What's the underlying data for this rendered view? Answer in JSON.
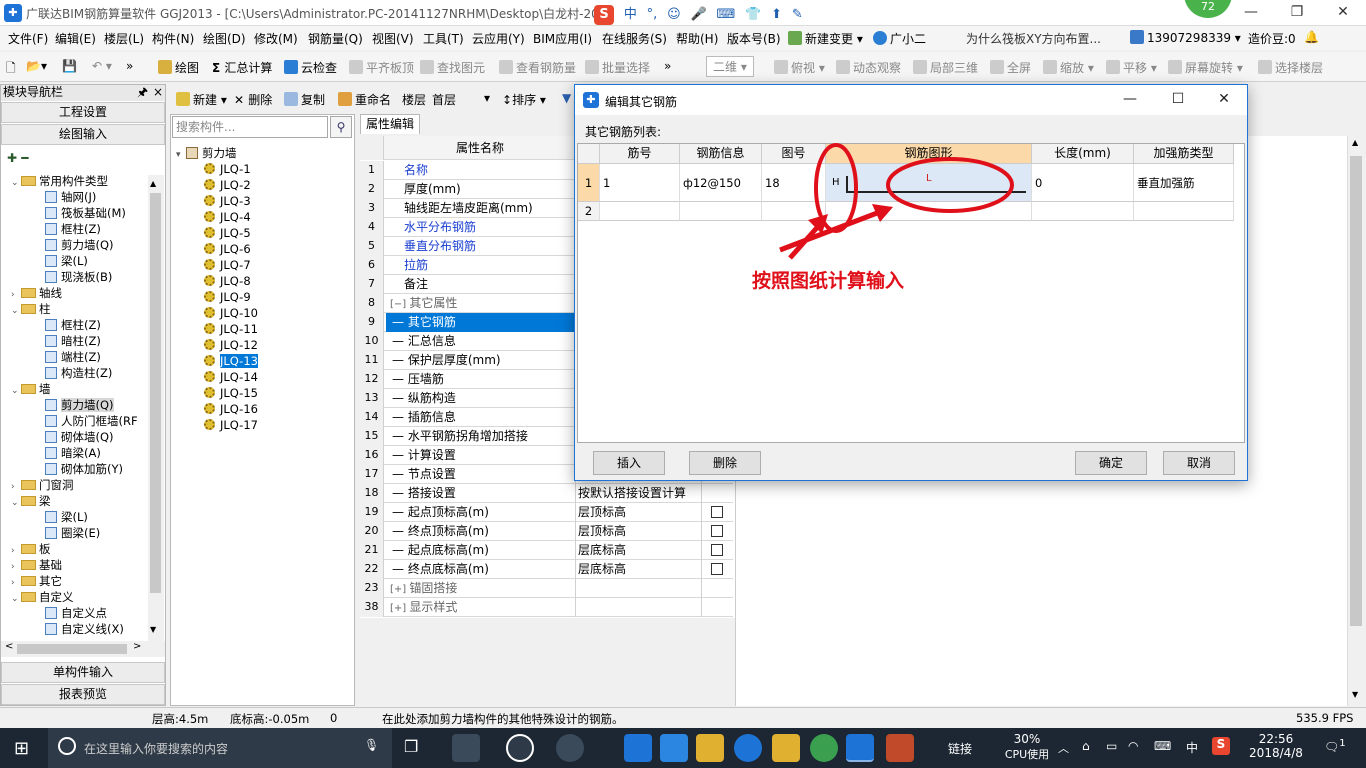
{
  "window": {
    "title": "广联达BIM钢筋算量软件 GGJ2013 - [C:\\Users\\Administrator.PC-20141127NRHM\\Desktop\\白龙村-20",
    "ime_label": "中",
    "badge_count": "72"
  },
  "menu": [
    "文件(F)",
    "编辑(E)",
    "楼层(L)",
    "构件(N)",
    "绘图(D)",
    "修改(M)",
    "钢筋量(Q)",
    "视图(V)",
    "工具(T)",
    "云应用(Y)",
    "BIM应用(I)",
    "在线服务(S)",
    "帮助(H)",
    "版本号(B)",
    "新建变更",
    "广小二"
  ],
  "menu_extra": {
    "link": "为什么筏板XY方向布置...",
    "phone": "13907298339",
    "price": "造价豆:0"
  },
  "toolbar": [
    "绘图",
    "汇总计算",
    "云检查",
    "平齐板顶",
    "查找图元",
    "查看钢筋量",
    "批量选择",
    "二维",
    "俯视",
    "动态观察",
    "局部三维",
    "全屏",
    "缩放",
    "平移",
    "屏幕旋转",
    "选择楼层"
  ],
  "nav": {
    "header": "模块导航栏",
    "btn_project": "工程设置",
    "btn_draw": "绘图输入",
    "btn_single": "单构件输入",
    "btn_report": "报表预览",
    "tree": [
      {
        "label": "常用构件类型",
        "level": 0,
        "type": "folder",
        "open": true
      },
      {
        "label": "轴网(J)",
        "level": 1,
        "type": "item"
      },
      {
        "label": "筏板基础(M)",
        "level": 1,
        "type": "item"
      },
      {
        "label": "框柱(Z)",
        "level": 1,
        "type": "item"
      },
      {
        "label": "剪力墙(Q)",
        "level": 1,
        "type": "item"
      },
      {
        "label": "梁(L)",
        "level": 1,
        "type": "item"
      },
      {
        "label": "现浇板(B)",
        "level": 1,
        "type": "item"
      },
      {
        "label": "轴线",
        "level": 0,
        "type": "folder",
        "open": false
      },
      {
        "label": "柱",
        "level": 0,
        "type": "folder",
        "open": true
      },
      {
        "label": "框柱(Z)",
        "level": 1,
        "type": "item"
      },
      {
        "label": "暗柱(Z)",
        "level": 1,
        "type": "item"
      },
      {
        "label": "端柱(Z)",
        "level": 1,
        "type": "item"
      },
      {
        "label": "构造柱(Z)",
        "level": 1,
        "type": "item"
      },
      {
        "label": "墙",
        "level": 0,
        "type": "folder",
        "open": true
      },
      {
        "label": "剪力墙(Q)",
        "level": 1,
        "type": "item",
        "selected": true
      },
      {
        "label": "人防门框墙(RF",
        "level": 1,
        "type": "item"
      },
      {
        "label": "砌体墙(Q)",
        "level": 1,
        "type": "item"
      },
      {
        "label": "暗梁(A)",
        "level": 1,
        "type": "item"
      },
      {
        "label": "砌体加筋(Y)",
        "level": 1,
        "type": "item"
      },
      {
        "label": "门窗洞",
        "level": 0,
        "type": "folder",
        "open": false
      },
      {
        "label": "梁",
        "level": 0,
        "type": "folder",
        "open": true
      },
      {
        "label": "梁(L)",
        "level": 1,
        "type": "item"
      },
      {
        "label": "圈梁(E)",
        "level": 1,
        "type": "item"
      },
      {
        "label": "板",
        "level": 0,
        "type": "folder",
        "open": false
      },
      {
        "label": "基础",
        "level": 0,
        "type": "folder",
        "open": false
      },
      {
        "label": "其它",
        "level": 0,
        "type": "folder",
        "open": false
      },
      {
        "label": "自定义",
        "level": 0,
        "type": "folder",
        "open": true
      },
      {
        "label": "自定义点",
        "level": 1,
        "type": "item"
      },
      {
        "label": "自定义线(X)",
        "level": 1,
        "type": "item"
      }
    ]
  },
  "subtoolbar": {
    "new": "新建",
    "delete": "删除",
    "copy": "复制",
    "rename": "重命名",
    "floor_label": "楼层",
    "floor_value": "首层",
    "sort": "排序"
  },
  "component_tree": {
    "search_placeholder": "搜索构件...",
    "root": "剪力墙",
    "items": [
      "JLQ-1",
      "JLQ-2",
      "JLQ-3",
      "JLQ-4",
      "JLQ-5",
      "JLQ-6",
      "JLQ-7",
      "JLQ-8",
      "JLQ-9",
      "JLQ-10",
      "JLQ-11",
      "JLQ-12",
      "JLQ-13",
      "JLQ-14",
      "JLQ-15",
      "JLQ-16",
      "JLQ-17"
    ],
    "selected": "JLQ-13"
  },
  "properties": {
    "tab": "属性编辑",
    "col_name": "属性名称",
    "rows": [
      {
        "n": "1",
        "label": "名称",
        "style": "blue",
        "value": "",
        "chk": false
      },
      {
        "n": "2",
        "label": "厚度(mm)",
        "style": "",
        "value": "",
        "chk": false
      },
      {
        "n": "3",
        "label": "轴线距左墙皮距离(mm)",
        "style": "",
        "value": "",
        "chk": false
      },
      {
        "n": "4",
        "label": "水平分布钢筋",
        "style": "blue",
        "value": "",
        "chk": false
      },
      {
        "n": "5",
        "label": "垂直分布钢筋",
        "style": "blue",
        "value": "",
        "chk": false
      },
      {
        "n": "6",
        "label": "拉筋",
        "style": "blue",
        "value": "",
        "chk": false
      },
      {
        "n": "7",
        "label": "备注",
        "style": "",
        "value": "",
        "chk": false
      },
      {
        "n": "8",
        "label": "其它属性",
        "style": "grey",
        "value": "",
        "chk": false,
        "group": "−"
      },
      {
        "n": "9",
        "label": "其它钢筋",
        "style": "sel",
        "value": "",
        "chk": false
      },
      {
        "n": "10",
        "label": "汇总信息",
        "style": "",
        "value": "",
        "chk": false
      },
      {
        "n": "11",
        "label": "保护层厚度(mm)",
        "style": "",
        "value": "",
        "chk": false
      },
      {
        "n": "12",
        "label": "压墙筋",
        "style": "",
        "value": "",
        "chk": false
      },
      {
        "n": "13",
        "label": "纵筋构造",
        "style": "",
        "value": "",
        "chk": false
      },
      {
        "n": "14",
        "label": "插筋信息",
        "style": "",
        "value": "",
        "chk": false
      },
      {
        "n": "15",
        "label": "水平钢筋拐角增加搭接",
        "style": "",
        "value": "",
        "chk": false
      },
      {
        "n": "16",
        "label": "计算设置",
        "style": "",
        "value": "",
        "chk": false
      },
      {
        "n": "17",
        "label": "节点设置",
        "style": "",
        "value": "",
        "chk": false
      },
      {
        "n": "18",
        "label": "搭接设置",
        "style": "",
        "value": "按默认搭接设置计算",
        "chk": false
      },
      {
        "n": "19",
        "label": "起点顶标高(m)",
        "style": "",
        "value": "层顶标高",
        "chk": true
      },
      {
        "n": "20",
        "label": "终点顶标高(m)",
        "style": "",
        "value": "层顶标高",
        "chk": true
      },
      {
        "n": "21",
        "label": "起点底标高(m)",
        "style": "",
        "value": "层底标高",
        "chk": true
      },
      {
        "n": "22",
        "label": "终点底标高(m)",
        "style": "",
        "value": "层底标高",
        "chk": true
      },
      {
        "n": "23",
        "label": "锚固搭接",
        "style": "grey",
        "value": "",
        "chk": false,
        "group": "+"
      },
      {
        "n": "38",
        "label": "显示样式",
        "style": "grey",
        "value": "",
        "chk": false,
        "group": "+"
      }
    ]
  },
  "dialog": {
    "title": "编辑其它钢筋",
    "list_label": "其它钢筋列表:",
    "columns": [
      "筋号",
      "钢筋信息",
      "图号",
      "钢筋图形",
      "长度(mm)",
      "加强筋类型"
    ],
    "rows": [
      {
        "idx": "1",
        "jinhao": "1",
        "info": "ф12@150",
        "tuhao": "18",
        "shape_h": "H",
        "shape_l": "L",
        "length": "0",
        "type": "垂直加强筋"
      },
      {
        "idx": "2",
        "jinhao": "",
        "info": "",
        "tuhao": "",
        "shape_h": "",
        "shape_l": "",
        "length": "",
        "type": ""
      }
    ],
    "btn_insert": "插入",
    "btn_delete": "删除",
    "btn_ok": "确定",
    "btn_cancel": "取消"
  },
  "annotation": {
    "text": "按照图纸计算输入",
    "color": "#e0101a"
  },
  "status": {
    "floor_height": "层高:4.5m",
    "bottom_elev": "底标高:-0.05m",
    "value": "0",
    "message": "在此处添加剪力墙构件的其他特殊设计的钢筋。",
    "fps": "535.9 FPS"
  },
  "taskbar": {
    "search_placeholder": "在这里输入你要搜索的内容",
    "tray_label": "链接",
    "cpu_percent": "30%",
    "cpu_label": "CPU使用",
    "ime": "中",
    "time": "22:56",
    "date": "2018/4/8",
    "notif_count": "1"
  }
}
